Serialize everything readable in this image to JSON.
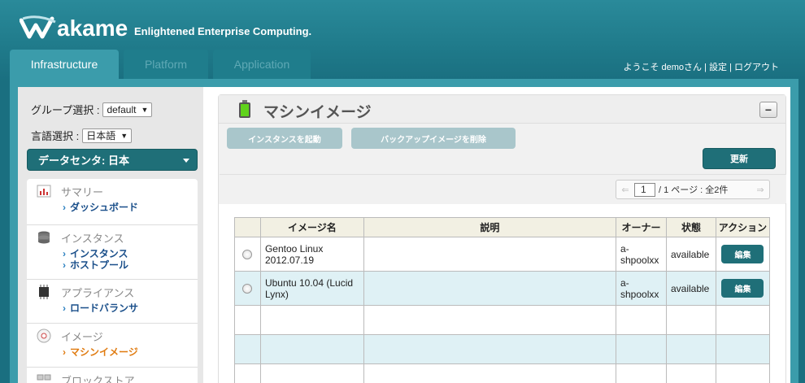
{
  "header": {
    "logo_text": "akame",
    "tagline": "Enlightened Enterprise Computing."
  },
  "tabs": [
    {
      "label": "Infrastructure",
      "active": true
    },
    {
      "label": "Platform",
      "active": false
    },
    {
      "label": "Application",
      "active": false
    }
  ],
  "user_bar": {
    "welcome": "ようこそ demoさん",
    "sep1": "|",
    "settings": "設定",
    "sep2": "|",
    "logout": "ログアウト"
  },
  "sidebar": {
    "group_label": "グループ選択 :",
    "group_value": "default",
    "lang_label": "言語選択 :",
    "lang_value": "日本語",
    "datacenter": "データセンタ: 日本",
    "menu": [
      {
        "title": "サマリー",
        "icon": "chart-icon",
        "links": [
          "ダッシュボード"
        ]
      },
      {
        "title": "インスタンス",
        "icon": "database-icon",
        "links": [
          "インスタンス",
          "ホストプール"
        ]
      },
      {
        "title": "アプライアンス",
        "icon": "chip-icon",
        "links": [
          "ロードバランサ"
        ]
      },
      {
        "title": "イメージ",
        "icon": "disc-icon",
        "links": [
          "マシンイメージ"
        ]
      },
      {
        "title": "ブロックストア",
        "icon": "blocks-icon",
        "links": []
      }
    ]
  },
  "panel": {
    "title": "マシンイメージ",
    "collapse_label": "−",
    "launch_button": "インスタンスを起動",
    "delete_backup_button": "バックアップイメージを削除",
    "refresh_button": "更新",
    "pager": {
      "prev": "⇐",
      "current": "1",
      "text": "/ 1 ページ : 全2件",
      "next": "⇒"
    },
    "table": {
      "columns": [
        "",
        "イメージ名",
        "説明",
        "オーナー",
        "状態",
        "アクション"
      ],
      "rows": [
        {
          "name": "Gentoo Linux 2012.07.19",
          "description": "",
          "owner": "a-shpoolxx",
          "state": "available",
          "action": "編集"
        },
        {
          "name": "Ubuntu 10.04 (Lucid Lynx)",
          "description": "",
          "owner": "a-shpoolxx",
          "state": "available",
          "action": "編集"
        }
      ]
    }
  },
  "colors": {
    "header_bg": "#1f7a8a",
    "accent_dark": "#1f6f78",
    "active_link": "#e07b10",
    "table_alt_row": "#dff1f5"
  }
}
